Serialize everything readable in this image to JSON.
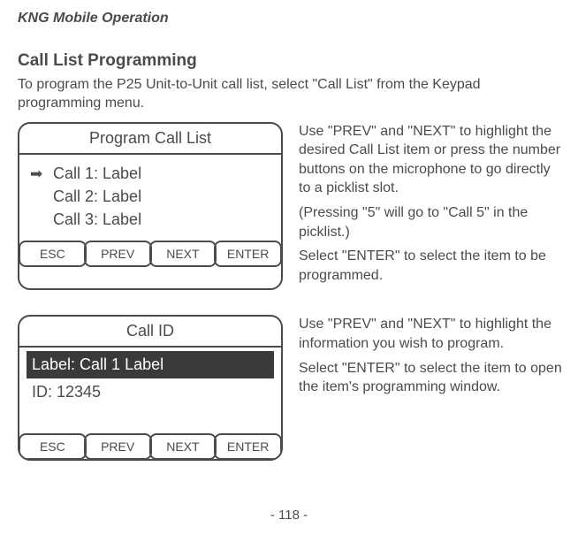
{
  "doc_section": "KNG Mobile Operation",
  "page_title": "Call List Programming",
  "intro": "To program the P25 Unit-to-Unit call list, select \"Call List\" from the Keypad programming menu.",
  "panel1": {
    "header": "Program Call List",
    "rows": [
      {
        "marker": "➡",
        "label": "Call 1: Label"
      },
      {
        "marker": "",
        "label": "Call 2: Label"
      },
      {
        "marker": "",
        "label": "Call 3: Label"
      }
    ],
    "buttons": [
      "ESC",
      "PREV",
      "NEXT",
      "ENTER"
    ]
  },
  "desc1": {
    "p1": "Use \"PREV\" and \"NEXT\" to highlight the desired Call List item or press the number buttons on the microphone to go directly to a picklist slot.",
    "p2": "(Pressing \"5\" will go to \"Call 5\" in the picklist.)",
    "p3": "Select \"ENTER\" to select the item to be programmed."
  },
  "panel2": {
    "header": "Call ID",
    "highlight": "Label: Call 1 Label",
    "id_line": "ID: 12345",
    "buttons": [
      "ESC",
      "PREV",
      "NEXT",
      "ENTER"
    ]
  },
  "desc2": {
    "p1": "Use \"PREV\" and \"NEXT\" to highlight the information you wish to program.",
    "p2": "Select \"ENTER\" to select the item to open the item's programming window."
  },
  "page_number": "- 118 -"
}
